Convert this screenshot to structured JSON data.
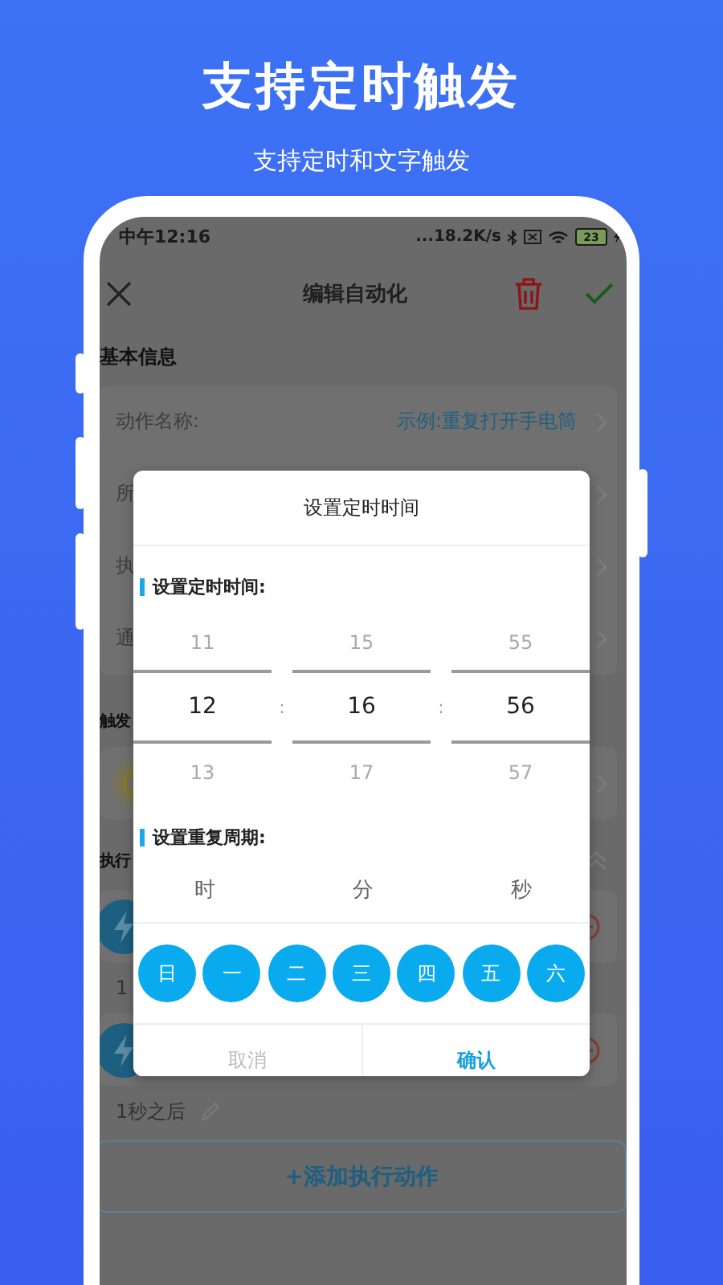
{
  "promo": {
    "title": "支持定时触发",
    "subtitle": "支持定时和文字触发"
  },
  "status_bar": {
    "time": "中午12:16",
    "speed": "...18.2K/s",
    "battery": "23"
  },
  "toolbar": {
    "title": "编辑自动化"
  },
  "basic_info": {
    "heading": "基本信息",
    "rows": [
      {
        "label": "动作名称:",
        "value": "示例:重复打开手电筒"
      },
      {
        "label": "所"
      },
      {
        "label": "执"
      },
      {
        "label": "通"
      }
    ]
  },
  "trigger": {
    "heading": "触发"
  },
  "actions": {
    "heading": "执行",
    "items": [
      {
        "note": "1"
      },
      {
        "note": "1秒之后"
      }
    ],
    "add_button": "+添加执行动作"
  },
  "dialog": {
    "title": "设置定时时间",
    "time_heading": "设置定时时间:",
    "columns": [
      {
        "above": "11",
        "value": "12",
        "below": "13"
      },
      {
        "above": "15",
        "value": "16",
        "below": "17"
      },
      {
        "above": "55",
        "value": "56",
        "below": "57"
      }
    ],
    "separators": [
      ":",
      ":"
    ],
    "repeat_heading": "设置重复周期:",
    "units": [
      "时",
      "分",
      "秒"
    ],
    "weekdays": [
      {
        "label": "日",
        "selected": true
      },
      {
        "label": "一",
        "selected": true
      },
      {
        "label": "二",
        "selected": true
      },
      {
        "label": "三",
        "selected": true
      },
      {
        "label": "四",
        "selected": true
      },
      {
        "label": "五",
        "selected": true
      },
      {
        "label": "六",
        "selected": true
      }
    ],
    "cancel": "取消",
    "confirm": "确认"
  }
}
